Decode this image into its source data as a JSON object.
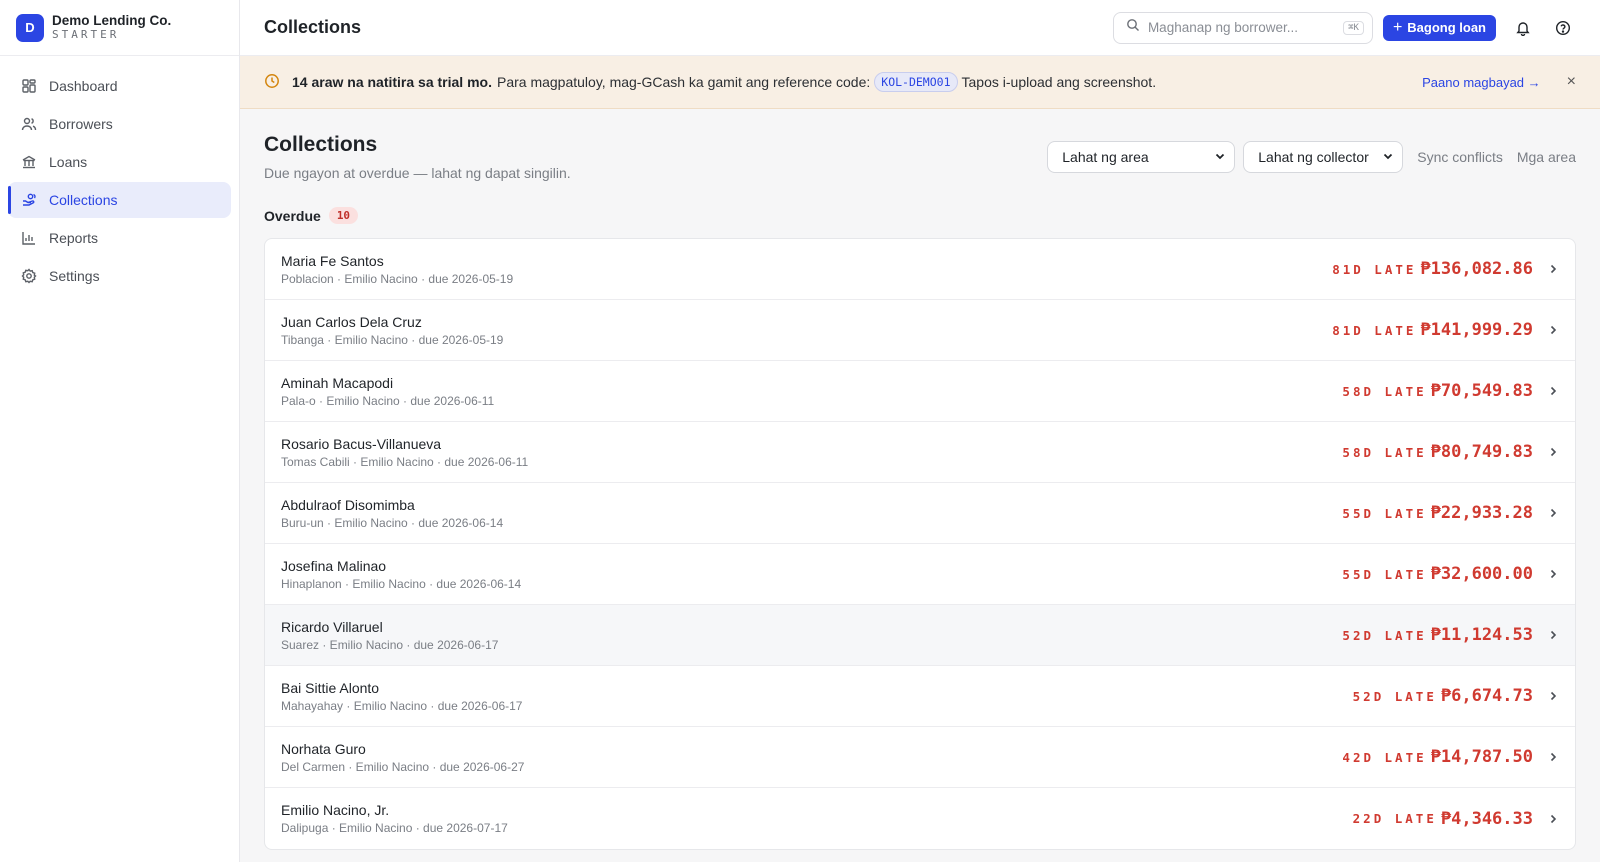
{
  "brand": {
    "initial": "D",
    "name": "Demo Lending Co.",
    "plan": "STARTER",
    "color": "#2b45e3"
  },
  "sidebar": {
    "items": [
      {
        "label": "Dashboard",
        "icon": "grid-icon",
        "active": false
      },
      {
        "label": "Borrowers",
        "icon": "users-icon",
        "active": false
      },
      {
        "label": "Loans",
        "icon": "bank-icon",
        "active": false
      },
      {
        "label": "Collections",
        "icon": "hand-coins-icon",
        "active": true
      },
      {
        "label": "Reports",
        "icon": "bar-chart-icon",
        "active": false
      },
      {
        "label": "Settings",
        "icon": "gear-icon",
        "active": false
      }
    ]
  },
  "topbar": {
    "title": "Collections",
    "search_placeholder": "Maghanap ng borrower...",
    "search_shortcut": "⌘K",
    "new_loan_label": "Bagong loan"
  },
  "banner": {
    "strong": "14 araw na natitira sa trial mo.",
    "text": "Para magpatuloy, mag-GCash ka gamit ang reference code:",
    "ref_code": "KOL-DEMO01",
    "text2": "Tapos i-upload ang screenshot.",
    "link": "Paano magbayad →",
    "close": "×"
  },
  "page": {
    "title": "Collections",
    "subtitle": "Due ngayon at overdue — lahat ng dapat singilin.",
    "area_filter": "Lahat ng area",
    "collector_filter": "Lahat ng collector",
    "sync_conflicts": "Sync conflicts",
    "areas_link": "Mga area"
  },
  "overdue": {
    "title": "Overdue",
    "count": "10",
    "rows": [
      {
        "name": "Maria Fe Santos",
        "meta": "Poblacion · Emilio Nacino · due 2026-05-19",
        "late": "81D LATE",
        "amount": "₱136,082.86"
      },
      {
        "name": "Juan Carlos Dela Cruz",
        "meta": "Tibanga · Emilio Nacino · due 2026-05-19",
        "late": "81D LATE",
        "amount": "₱141,999.29"
      },
      {
        "name": "Aminah Macapodi",
        "meta": "Pala-o · Emilio Nacino · due 2026-06-11",
        "late": "58D LATE",
        "amount": "₱70,549.83"
      },
      {
        "name": "Rosario Bacus-Villanueva",
        "meta": "Tomas Cabili · Emilio Nacino · due 2026-06-11",
        "late": "58D LATE",
        "amount": "₱80,749.83"
      },
      {
        "name": "Abdulraof Disomimba",
        "meta": "Buru-un · Emilio Nacino · due 2026-06-14",
        "late": "55D LATE",
        "amount": "₱22,933.28"
      },
      {
        "name": "Josefina Malinao",
        "meta": "Hinaplanon · Emilio Nacino · due 2026-06-14",
        "late": "55D LATE",
        "amount": "₱32,600.00"
      },
      {
        "name": "Ricardo Villaruel",
        "meta": "Suarez · Emilio Nacino · due 2026-06-17",
        "late": "52D LATE",
        "amount": "₱11,124.53"
      },
      {
        "name": "Bai Sittie Alonto",
        "meta": "Mahayahay · Emilio Nacino · due 2026-06-17",
        "late": "52D LATE",
        "amount": "₱6,674.73"
      },
      {
        "name": "Norhata Guro",
        "meta": "Del Carmen · Emilio Nacino · due 2026-06-27",
        "late": "42D LATE",
        "amount": "₱14,787.50"
      },
      {
        "name": "Emilio Nacino, Jr.",
        "meta": "Dalipuga · Emilio Nacino · due 2026-07-17",
        "late": "22D LATE",
        "amount": "₱4,346.33"
      }
    ]
  },
  "colors": {
    "accent": "#2b45e3",
    "danger": "#d03a30",
    "banner_bg": "#f8efe4"
  }
}
